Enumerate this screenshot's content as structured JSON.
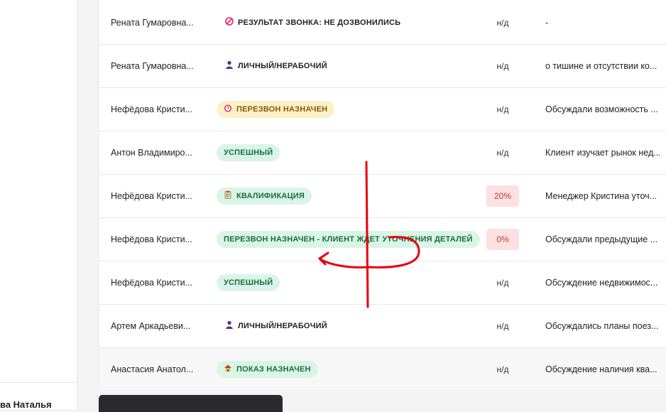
{
  "sidebar": {
    "user_name": "ва Наталья"
  },
  "rows": [
    {
      "name": "Рената Гумаровна...",
      "status": "РЕЗУЛЬТАТ ЗВОНКА: НЕ ДОЗВОНИЛИСЬ",
      "style": "plain",
      "icon": "no-entry-icon",
      "score": "н/д",
      "comment": "-"
    },
    {
      "name": "Рената Гумаровна...",
      "status": "ЛИЧНЫЙ/НЕРАБОЧИЙ",
      "style": "plain",
      "icon": "person-icon",
      "score": "н/д",
      "comment": "о тишине и отсутствии ко..."
    },
    {
      "name": "Нефёдова Кристи...",
      "status": "ПЕРЕЗВОН НАЗНАЧЕН",
      "style": "yellow",
      "icon": "alarm-clock-icon",
      "score": "н/д",
      "comment": "Обсуждали возможность ..."
    },
    {
      "name": "Антон Владимиро...",
      "status": "УСПЕШНЫЙ",
      "style": "green",
      "icon": "",
      "score": "н/д",
      "comment": "Клиент изучает рынок нед..."
    },
    {
      "name": "Нефёдова Кристи...",
      "status": "КВАЛИФИКАЦИЯ",
      "style": "green",
      "icon": "clipboard-icon",
      "score": "20%",
      "score_badge": true,
      "comment": "Менеджер Кристина уточ..."
    },
    {
      "name": "Нефёдова Кристи...",
      "status": "ПЕРЕЗВОН НАЗНАЧЕН - КЛИЕНТ ЖДЕТ УТОЧНЕНИЯ ДЕТАЛЕЙ",
      "style": "green",
      "icon": "",
      "score": "0%",
      "score_badge": true,
      "comment": "Обсуждали предыдущие ..."
    },
    {
      "name": "Нефёдова Кристи...",
      "status": "УСПЕШНЫЙ",
      "style": "green",
      "icon": "",
      "score": "н/д",
      "comment": "Обсуждение недвижимос..."
    },
    {
      "name": "Артем Аркадьеви...",
      "status": "ЛИЧНЫЙ/НЕРАБОЧИЙ",
      "style": "plain",
      "icon": "person-icon",
      "score": "н/д",
      "comment": "Обсуждались планы поез..."
    },
    {
      "name": "Анастасия Анатол...",
      "status": "ПОКАЗ НАЗНАЧЕН",
      "style": "green",
      "icon": "house-icon",
      "score": "н/д",
      "comment": "Обсуждение наличия ква..."
    }
  ],
  "colors": {
    "accent_green_bg": "#d9f5e6",
    "accent_green_text": "#1c6b44",
    "yellow_bg": "#fdf0c6",
    "score_badge_bg": "#fbe1e1",
    "annotation_red": "#e8000b"
  }
}
